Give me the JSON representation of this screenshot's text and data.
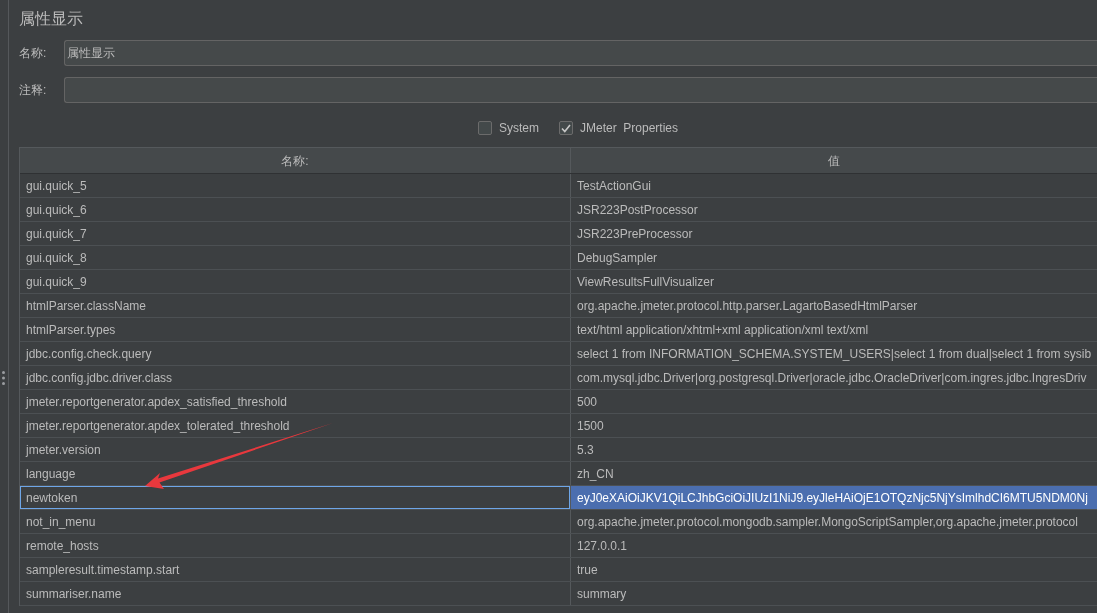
{
  "panel": {
    "title": "属性显示"
  },
  "fields": [
    {
      "label": "名称:",
      "value": "属性显示"
    },
    {
      "label": "注释:"
    }
  ],
  "options": [
    {
      "label": "System",
      "checked": false
    },
    {
      "label": "JMeter  Properties",
      "checked": true
    }
  ],
  "table": {
    "columns": [
      "名称:",
      "值"
    ],
    "rows": [
      {
        "name": "gui.quick_5",
        "value": "TestActionGui",
        "selected": false
      },
      {
        "name": "gui.quick_6",
        "value": "JSR223PostProcessor",
        "selected": false
      },
      {
        "name": "gui.quick_7",
        "value": "JSR223PreProcessor",
        "selected": false
      },
      {
        "name": "gui.quick_8",
        "value": "DebugSampler",
        "selected": false
      },
      {
        "name": "gui.quick_9",
        "value": "ViewResultsFullVisualizer",
        "selected": false
      },
      {
        "name": "htmlParser.className",
        "value": "org.apache.jmeter.protocol.http.parser.LagartoBasedHtmlParser",
        "selected": false
      },
      {
        "name": "htmlParser.types",
        "value": "text/html application/xhtml+xml application/xml text/xml",
        "selected": false
      },
      {
        "name": "jdbc.config.check.query",
        "value": "select 1 from INFORMATION_SCHEMA.SYSTEM_USERS|select 1 from dual|select 1 from sysib",
        "selected": false
      },
      {
        "name": "jdbc.config.jdbc.driver.class",
        "value": "com.mysql.jdbc.Driver|org.postgresql.Driver|oracle.jdbc.OracleDriver|com.ingres.jdbc.IngresDriv",
        "selected": false
      },
      {
        "name": "jmeter.reportgenerator.apdex_satisfied_threshold",
        "value": "500",
        "selected": false
      },
      {
        "name": "jmeter.reportgenerator.apdex_tolerated_threshold",
        "value": "1500",
        "selected": false
      },
      {
        "name": "jmeter.version",
        "value": "5.3",
        "selected": false
      },
      {
        "name": "language",
        "value": "zh_CN",
        "selected": false
      },
      {
        "name": "newtoken",
        "value": "eyJ0eXAiOiJKV1QiLCJhbGciOiJIUzI1NiJ9.eyJleHAiOjE1OTQzNjc5NjYsImlhdCI6MTU5NDM0Nj",
        "selected": true
      },
      {
        "name": "not_in_menu",
        "value": "org.apache.jmeter.protocol.mongodb.sampler.MongoScriptSampler,org.apache.jmeter.protocol",
        "selected": false
      },
      {
        "name": "remote_hosts",
        "value": "127.0.0.1",
        "selected": false
      },
      {
        "name": "sampleresult.timestamp.start",
        "value": "true",
        "selected": false
      },
      {
        "name": "summariser.name",
        "value": "summary",
        "selected": false
      }
    ]
  }
}
